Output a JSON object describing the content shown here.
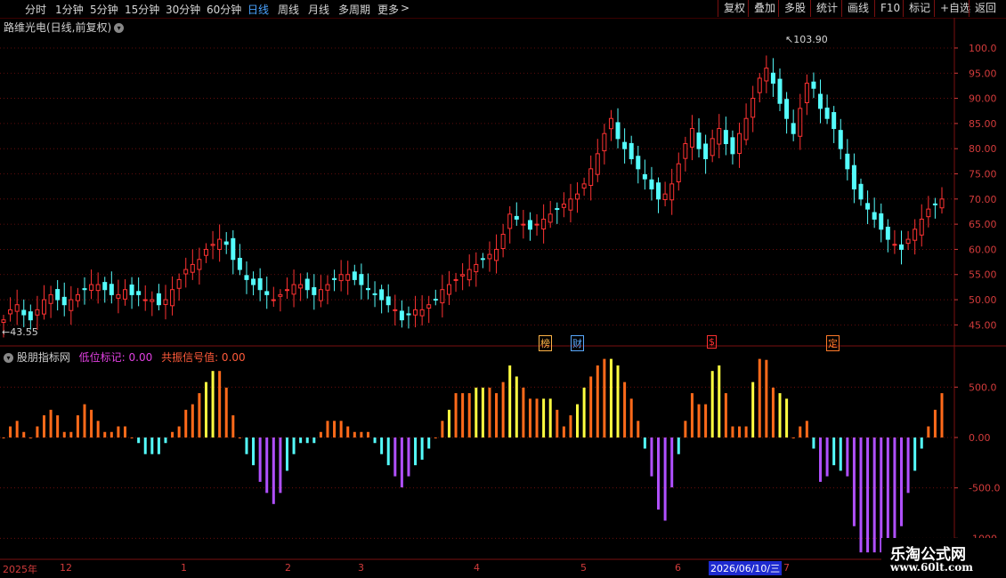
{
  "toolbar": {
    "periods": [
      {
        "label": "分时",
        "active": false
      },
      {
        "label": "1分钟",
        "active": false
      },
      {
        "label": "5分钟",
        "active": false
      },
      {
        "label": "15分钟",
        "active": false
      },
      {
        "label": "30分钟",
        "active": false
      },
      {
        "label": "60分钟",
        "active": false
      },
      {
        "label": "日线",
        "active": true
      },
      {
        "label": "周线",
        "active": false
      },
      {
        "label": "月线",
        "active": false
      },
      {
        "label": "多周期",
        "active": false
      },
      {
        "label": "更多",
        "active": false
      }
    ],
    "more_arrow": ">",
    "tools": [
      "复权",
      "叠加",
      "多股",
      "统计",
      "画线",
      "F10",
      "标记",
      "+自选",
      "返回"
    ]
  },
  "stock": {
    "title": "路维光电(日线,前复权)",
    "high_mark": "103.90",
    "low_mark": "43.55"
  },
  "price_axis": [
    "100.0",
    "95.00",
    "90.00",
    "85.00",
    "80.00",
    "75.00",
    "70.00",
    "65.00",
    "60.00",
    "55.00",
    "50.00",
    "45.00"
  ],
  "indicator": {
    "name": "股朋指标网",
    "low_label": "低位标记: 0.00",
    "resonance_label": "共振信号值: 0.00",
    "axis": [
      "500.0",
      "0.00",
      "-500.0",
      "-1000"
    ]
  },
  "events": [
    {
      "label": "榜",
      "color": "#ffb347"
    },
    {
      "label": "财",
      "color": "#5aa9ff"
    },
    {
      "label": "$",
      "color": "#ff3030"
    },
    {
      "label": "定",
      "color": "#ff7a2a"
    }
  ],
  "dates": {
    "labels": [
      "2025年",
      "12",
      "1",
      "2",
      "3",
      "4",
      "5",
      "6",
      "7"
    ],
    "cursor": "2026/06/10/三"
  },
  "watermark": {
    "line1": "乐淘公式网",
    "line2": "www.60lt.com"
  },
  "colors": {
    "up": "#ff3232",
    "down": "#54fcfc",
    "grid": "#7a1010",
    "hist_orange": "#ff6a1a",
    "hist_yellow": "#ffff40",
    "hist_cyan": "#54fcfc",
    "hist_purple": "#b050ff"
  },
  "chart_data": {
    "type": "candlestick",
    "price_range": [
      41,
      106
    ],
    "indicator_range": [
      -1200,
      900
    ],
    "closes": [
      46,
      48,
      49,
      47,
      46,
      48,
      50,
      51,
      50,
      49,
      50,
      51,
      52,
      53,
      53,
      52,
      51,
      51,
      52,
      51,
      51,
      50,
      50,
      49,
      50,
      52,
      54,
      56,
      57,
      58,
      60,
      61,
      62,
      61,
      58,
      56,
      54,
      53,
      52,
      51,
      50,
      51,
      52,
      53,
      53,
      52,
      51,
      52,
      53,
      54,
      55,
      55,
      54,
      53,
      52,
      51,
      50,
      49,
      48,
      46,
      47,
      48,
      48,
      49,
      50,
      52,
      53,
      54,
      55,
      56,
      57,
      58,
      59,
      60,
      63,
      67,
      66,
      65,
      64,
      65,
      66,
      67,
      68,
      69,
      70,
      71,
      73,
      76,
      79,
      83,
      86,
      82,
      80,
      78,
      76,
      74,
      72,
      70,
      71,
      73,
      77,
      81,
      84,
      80,
      78,
      82,
      84,
      81,
      79,
      83,
      86,
      90,
      94,
      96,
      93,
      89,
      86,
      83,
      88,
      93,
      92,
      88,
      86,
      84,
      80,
      76,
      72,
      70,
      68,
      66,
      64,
      62,
      61,
      60,
      62,
      64,
      66,
      68,
      69,
      70
    ]
  }
}
